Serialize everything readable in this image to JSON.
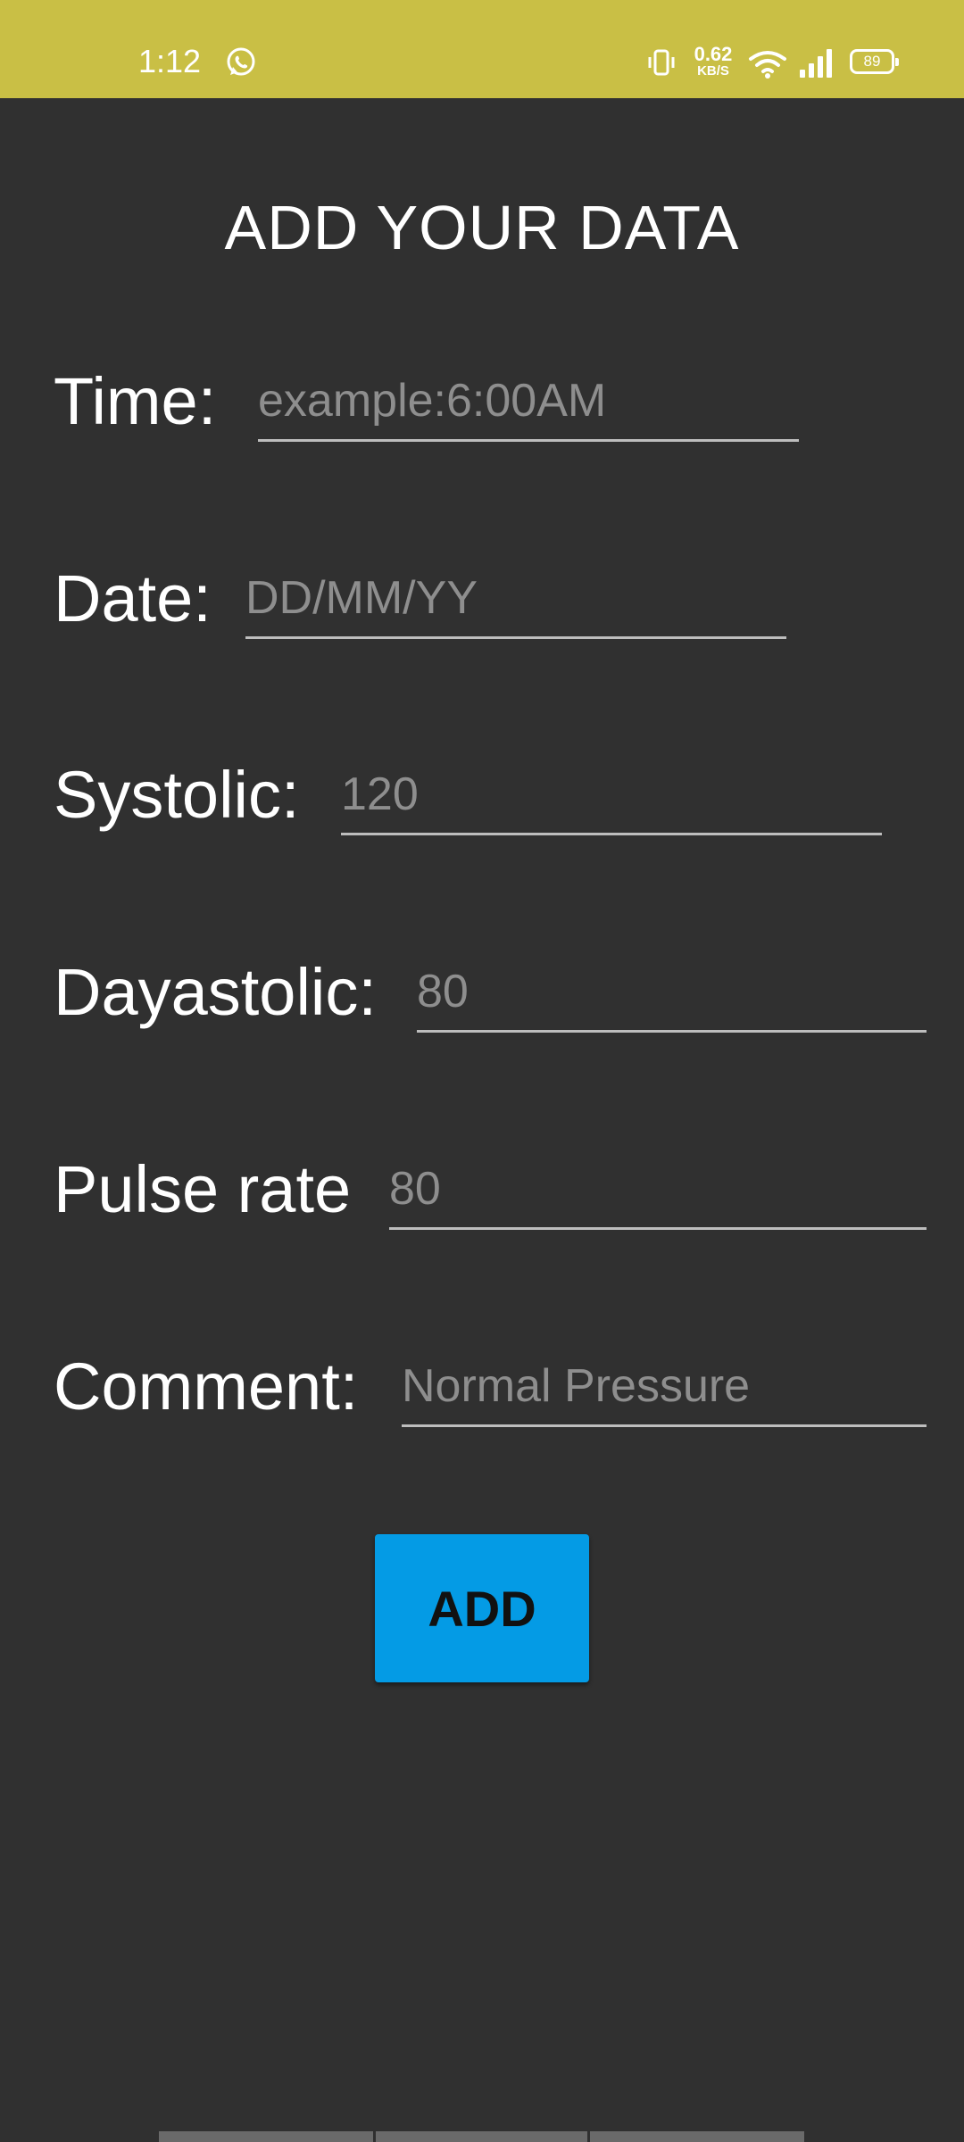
{
  "status_bar": {
    "time": "1:12",
    "net_speed_value": "0.62",
    "net_speed_unit": "KB/S",
    "battery_level": "89",
    "background_color": "#c9bf45",
    "icons": [
      "whatsapp-icon",
      "vibrate-icon",
      "wifi-icon",
      "cell-signal-icon",
      "battery-icon"
    ]
  },
  "page": {
    "title": "ADD YOUR DATA",
    "background_color": "#303030"
  },
  "form": {
    "time_label": "Time:",
    "time_placeholder": "example:6:00AM",
    "date_label": "Date:",
    "date_placeholder": "DD/MM/YY",
    "systolic_label": "Systolic:",
    "systolic_placeholder": "120",
    "diastolic_label": "Dayastolic:",
    "diastolic_placeholder": "80",
    "pulse_label": "Pulse rate",
    "pulse_placeholder": "80",
    "comment_label": "Comment:",
    "comment_placeholder": "Normal Pressure"
  },
  "actions": {
    "add_label": "ADD",
    "add_color": "#049be5"
  }
}
